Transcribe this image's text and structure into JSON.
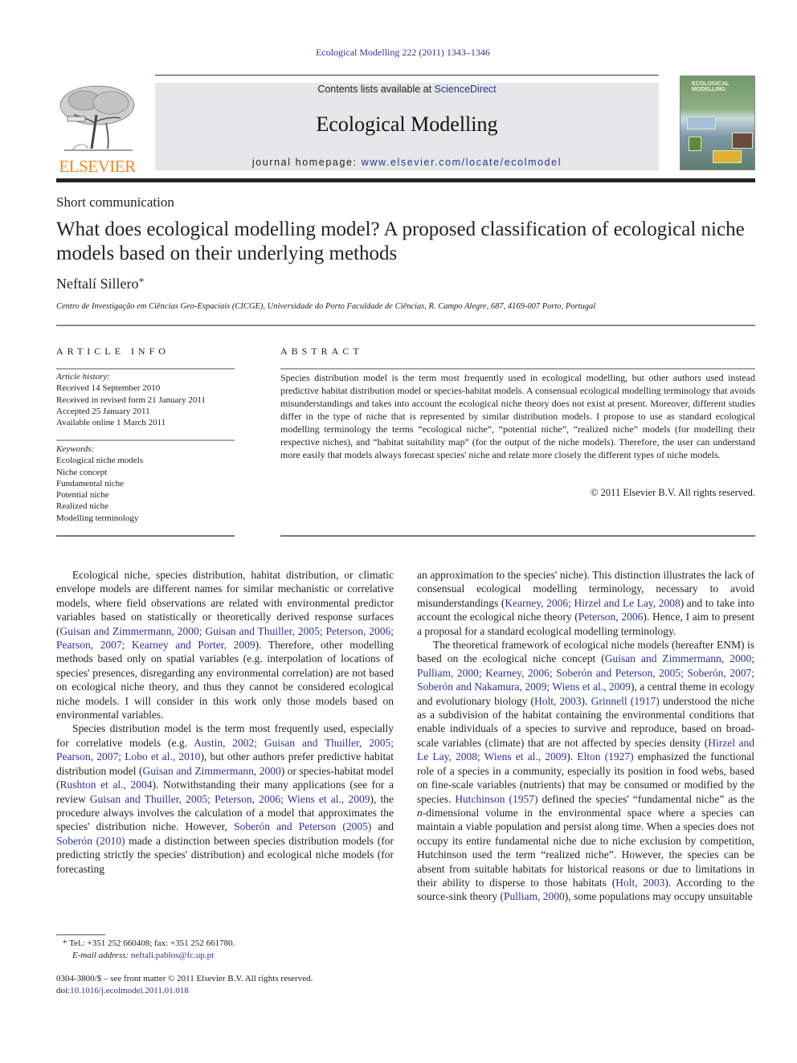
{
  "header": {
    "citation": "Ecological Modelling 222 (2011) 1343–1346",
    "publisher_logo_text": "ELSEVIER",
    "contents_prefix": "Contents lists available at ",
    "contents_link": "ScienceDirect",
    "journal_name": "Ecological Modelling",
    "homepage_prefix": "journal homepage: ",
    "homepage_link": "www.elsevier.com/locate/ecolmodel",
    "cover_title_line1": "ECOLOGICAL",
    "cover_title_line2": "MODELLING"
  },
  "article": {
    "section_type": "Short communication",
    "title": "What does ecological modelling model? A proposed classification of ecological niche models based on their underlying methods",
    "author": "Neftalí Sillero",
    "author_mark": "*",
    "affiliation": "Centro de Investigação em Ciências Geo-Espaciais (CICGE), Universidade do Porto Faculdade de Ciências, R. Campo Alegre, 687, 4169-007 Porto, Portugal"
  },
  "article_info": {
    "heading": "ARTICLE INFO",
    "history_label": "Article history:",
    "history": [
      "Received 14 September 2010",
      "Received in revised form 21 January 2011",
      "Accepted 25 January 2011",
      "Available online 1 March 2011"
    ],
    "keywords_label": "Keywords:",
    "keywords": [
      "Ecological niche models",
      "Niche concept",
      "Fundamental niche",
      "Potential niche",
      "Realized niche",
      "Modelling terminology"
    ]
  },
  "abstract": {
    "heading": "ABSTRACT",
    "text": "Species distribution model is the term most frequently used in ecological modelling, but other authors used instead predictive habitat distribution model or species-habitat models. A consensual ecological modelling terminology that avoids misunderstandings and takes into account the ecological niche theory does not exist at present. Moreover, different studies differ in the type of niche that is represented by similar distribution models. I propose to use as standard ecological modelling terminology the terms “ecological niche”, “potential niche”, “realized niche” models (for modelling their respective niches), and “habitat suitability map” (for the output of the niche models). Therefore, the user can understand more easily that models always forecast species' niche and relate more closely the different types of niche models.",
    "copyright": "© 2011 Elsevier B.V. All rights reserved."
  },
  "body": {
    "left_p1": [
      {
        "t": "Ecological niche, species distribution, habitat distribution, or climatic envelope models are different names for similar mechanistic or correlative models, where field observations are related with environmental predictor variables based on statistically or theoretically derived response surfaces ("
      },
      {
        "l": "Guisan and Zimmermann, 2000; Guisan and Thuiller, 2005; Peterson, 2006; Pearson, 2007; Kearney and Porter, 2009"
      },
      {
        "t": "). Therefore, other modelling methods based only on spatial variables (e.g. interpolation of locations of species' presences, disregarding any environmental correlation) are not based on ecological niche theory, and thus they cannot be considered ecological niche models. I will consider in this work only those models based on environmental variables."
      }
    ],
    "left_p2": [
      {
        "t": "Species distribution model is the term most frequently used, especially for correlative models (e.g. "
      },
      {
        "l": "Austin, 2002; Guisan and Thuiller, 2005; Pearson, 2007; Lobo et al., 2010"
      },
      {
        "t": "), but other authors prefer predictive habitat distribution model ("
      },
      {
        "l": "Guisan and Zimmermann, 2000"
      },
      {
        "t": ") or species-habitat model ("
      },
      {
        "l": "Rushton et al., 2004"
      },
      {
        "t": "). Notwithstanding their many applications (see for a review "
      },
      {
        "l": "Guisan and Thuiller, 2005; Peterson, 2006; Wiens et al., 2009"
      },
      {
        "t": "), the procedure always involves the calculation of a model that approximates the species' distribution niche. However, "
      },
      {
        "l": "Soberón and Peterson (2005)"
      },
      {
        "t": " and "
      },
      {
        "l": "Soberón (2010)"
      },
      {
        "t": " made a distinction between species distribution models (for predicting strictly the species' distribution) and ecological niche models (for forecasting"
      }
    ],
    "right_p1": [
      {
        "t": "an approximation to the species' niche). This distinction illustrates the lack of consensual ecological modelling terminology, necessary to avoid misunderstandings ("
      },
      {
        "l": "Kearney, 2006; Hirzel and Le Lay, 2008"
      },
      {
        "t": ") and to take into account the ecological niche theory ("
      },
      {
        "l": "Peterson, 2006"
      },
      {
        "t": "). Hence, I aim to present a proposal for a standard ecological modelling terminology."
      }
    ],
    "right_p2": [
      {
        "t": "The theoretical framework of ecological niche models (hereafter ENM) is based on the ecological niche concept ("
      },
      {
        "l": "Guisan and Zimmermann, 2000; Pulliam, 2000; Kearney, 2006; Soberón and Peterson, 2005; Soberón, 2007; Soberón and Nakamura, 2009; Wiens et al., 2009"
      },
      {
        "t": "), a central theme in ecology and evolutionary biology ("
      },
      {
        "l": "Holt, 2003"
      },
      {
        "t": "). "
      },
      {
        "l": "Grinnell (1917)"
      },
      {
        "t": " understood the niche as a subdivision of the habitat containing the environmental conditions that enable individuals of a species to survive and reproduce, based on broad-scale variables (climate) that are not affected by species density ("
      },
      {
        "l": "Hirzel and Le Lay, 2008; Wiens et al., 2009"
      },
      {
        "t": "). "
      },
      {
        "l": "Elton (1927)"
      },
      {
        "t": " emphasized the functional role of a species in a community, especially its position in food webs, based on fine-scale variables (nutrients) that may be consumed or modified by the species. "
      },
      {
        "l": "Hutchinson (1957)"
      },
      {
        "t": " defined the species' “fundamental niche” as the "
      },
      {
        "i": "n"
      },
      {
        "t": "-dimensional volume in the environmental space where a species can maintain a viable population and persist along time. When a species does not occupy its entire fundamental niche due to niche exclusion by competition, Hutchinson used the term “realized niche”. However, the species can be absent from suitable habitats for historical reasons or due to limitations in their ability to disperse to those habitats ("
      },
      {
        "l": "Holt, 2003"
      },
      {
        "t": "). According to the source-sink theory ("
      },
      {
        "l": "Pulliam, 2000"
      },
      {
        "t": "), some populations may occupy unsuitable"
      }
    ]
  },
  "footnote": {
    "mark": "*",
    "contact": "Tel.: +351 252 660408; fax: +351 252 661780.",
    "email_label": "E-mail address: ",
    "email": "neftali.pablos@fc.up.pt"
  },
  "front_matter": {
    "issn_line": "0304-3800/$ – see front matter © 2011 Elsevier B.V. All rights reserved.",
    "doi_prefix": "doi:",
    "doi": "10.1016/j.ecolmodel.2011.01.018"
  },
  "colors": {
    "link": "#2a3590",
    "elsevier_orange": "#f08a24",
    "banner_gray": "#e6e7e8"
  }
}
